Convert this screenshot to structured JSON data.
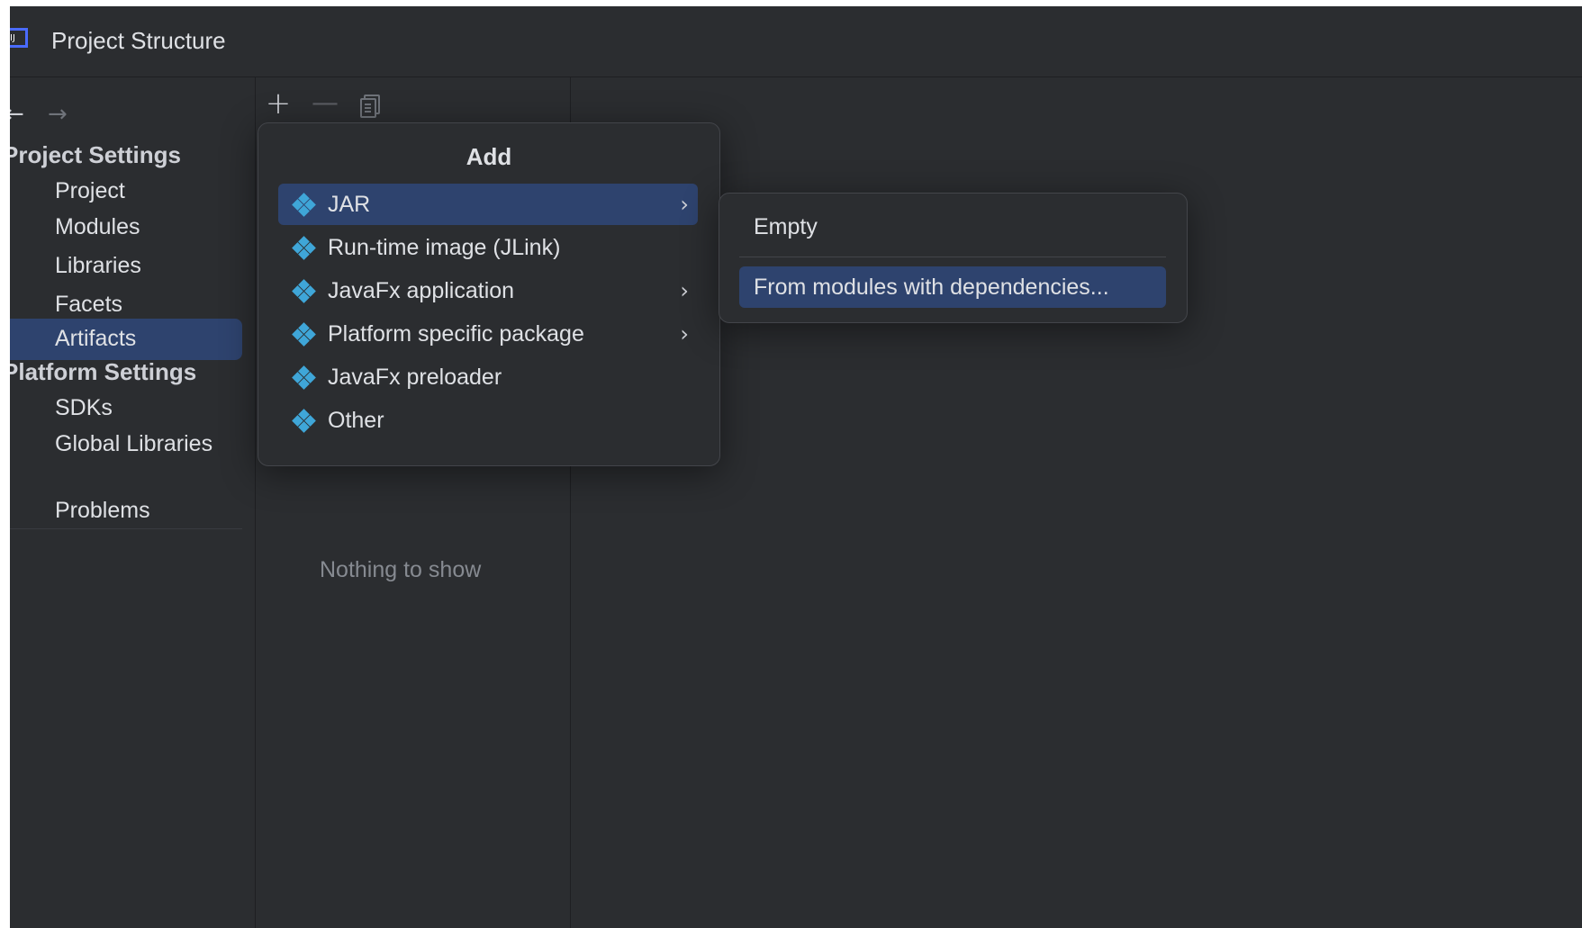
{
  "window": {
    "title": "Project Structure",
    "logo_text": "IJ"
  },
  "nav": {
    "back_glyph": "←",
    "forward_glyph": "→",
    "project_settings_header": "Project Settings",
    "platform_settings_header": "Platform Settings",
    "items": [
      {
        "label": "Project"
      },
      {
        "label": "Modules"
      },
      {
        "label": "Libraries"
      },
      {
        "label": "Facets"
      },
      {
        "label": "Artifacts",
        "selected": true
      },
      {
        "label": "SDKs"
      },
      {
        "label": "Global Libraries"
      },
      {
        "label": "Problems"
      }
    ]
  },
  "toolbar": {
    "add_glyph": "+",
    "remove_glyph": "—"
  },
  "middle": {
    "empty_text": "Nothing to show"
  },
  "popup": {
    "title": "Add",
    "items": [
      {
        "label": "JAR",
        "has_submenu": true,
        "selected": true
      },
      {
        "label": "Run-time image (JLink)",
        "has_submenu": false
      },
      {
        "label": "JavaFx application",
        "has_submenu": true
      },
      {
        "label": "Platform specific package",
        "has_submenu": true
      },
      {
        "label": "JavaFx preloader",
        "has_submenu": false
      },
      {
        "label": "Other",
        "has_submenu": false
      }
    ],
    "chevron_glyph": "›"
  },
  "submenu": {
    "items": [
      {
        "label": "Empty"
      },
      {
        "label": "From modules with dependencies...",
        "selected": true
      }
    ]
  },
  "colors": {
    "background": "#2b2d30",
    "selection": "#2e436e",
    "icon_accent": "#3fa6d8",
    "text": "#dfe1e5",
    "muted_text": "#868a91"
  }
}
